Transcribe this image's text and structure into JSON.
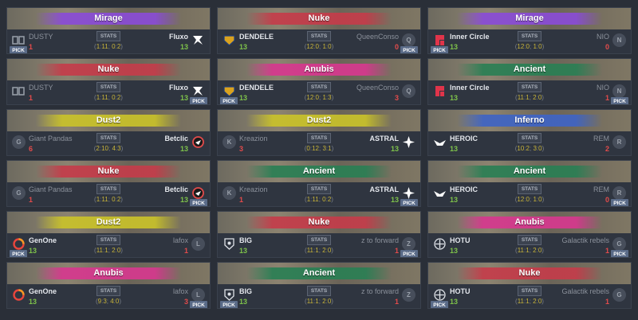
{
  "matches": [
    {
      "map": "Mirage",
      "banner": "#8a4cd6",
      "left": {
        "name": "DUSTY",
        "score": "1",
        "icon": "dusty-logo-icon",
        "pick": true,
        "win": false
      },
      "right": {
        "name": "Fluxo",
        "score": "13",
        "icon": "fluxo-logo-icon",
        "pick": false,
        "win": true
      },
      "halves": {
        "h1": [
          "1",
          "11"
        ],
        "h2": [
          "0",
          "2"
        ]
      }
    },
    {
      "map": "Nuke",
      "banner": "#c43c4a",
      "left": {
        "name": "DENDELE",
        "score": "13",
        "icon": "dendele-logo-icon",
        "pick": false,
        "win": true
      },
      "right": {
        "name": "QueenConso",
        "score": "0",
        "icon": "queenconso-placeholder-icon",
        "pick": true,
        "win": false
      },
      "halves": {
        "h1": [
          "12",
          "0"
        ],
        "h2": [
          "1",
          "0"
        ]
      }
    },
    {
      "map": "Mirage",
      "banner": "#8a4cd6",
      "left": {
        "name": "Inner Circle",
        "score": "13",
        "icon": "inner-circle-logo-icon",
        "pick": true,
        "win": true
      },
      "right": {
        "name": "NIO",
        "score": "0",
        "icon": "nio-placeholder-icon",
        "pick": false,
        "win": false
      },
      "halves": {
        "h1": [
          "12",
          "0"
        ],
        "h2": [
          "1",
          "0"
        ]
      }
    },
    {
      "map": "Nuke",
      "banner": "#c43c4a",
      "left": {
        "name": "DUSTY",
        "score": "1",
        "icon": "dusty-logo-icon",
        "pick": false,
        "win": false
      },
      "right": {
        "name": "Fluxo",
        "score": "13",
        "icon": "fluxo-logo-icon",
        "pick": true,
        "win": true
      },
      "halves": {
        "h1": [
          "1",
          "11"
        ],
        "h2": [
          "0",
          "2"
        ]
      }
    },
    {
      "map": "Anubis",
      "banner": "#d6388e",
      "left": {
        "name": "DENDELE",
        "score": "13",
        "icon": "dendele-logo-icon",
        "pick": true,
        "win": true
      },
      "right": {
        "name": "QueenConso",
        "score": "3",
        "icon": "queenconso-placeholder-icon",
        "pick": false,
        "win": false
      },
      "halves": {
        "h1": [
          "12",
          "0"
        ],
        "h2": [
          "1",
          "3"
        ]
      }
    },
    {
      "map": "Ancient",
      "banner": "#2a7f54",
      "left": {
        "name": "Inner Circle",
        "score": "13",
        "icon": "inner-circle-logo-icon",
        "pick": false,
        "win": true
      },
      "right": {
        "name": "NIO",
        "score": "1",
        "icon": "nio-placeholder-icon",
        "pick": true,
        "win": false
      },
      "halves": {
        "h1": [
          "11",
          "1"
        ],
        "h2": [
          "2",
          "0"
        ]
      }
    },
    {
      "map": "Dust2",
      "banner": "#c9c22a",
      "left": {
        "name": "Giant Pandas",
        "score": "6",
        "icon": "giant-pandas-placeholder-icon",
        "pick": false,
        "win": false
      },
      "right": {
        "name": "Betclic",
        "score": "13",
        "icon": "betclic-logo-icon",
        "pick": false,
        "win": true
      },
      "halves": {
        "h1": [
          "2",
          "10"
        ],
        "h2": [
          "4",
          "3"
        ]
      }
    },
    {
      "map": "Dust2",
      "banner": "#c9c22a",
      "left": {
        "name": "Kreazion",
        "score": "3",
        "icon": "kreazion-placeholder-icon",
        "pick": false,
        "win": false
      },
      "right": {
        "name": "ASTRAL",
        "score": "13",
        "icon": "astral-logo-icon",
        "pick": false,
        "win": true
      },
      "halves": {
        "h1": [
          "0",
          "12"
        ],
        "h2": [
          "3",
          "1"
        ]
      }
    },
    {
      "map": "Inferno",
      "banner": "#3f64c4",
      "left": {
        "name": "HEROIC",
        "score": "13",
        "icon": "heroic-logo-icon",
        "pick": false,
        "win": true
      },
      "right": {
        "name": "REM",
        "score": "2",
        "icon": "rem-placeholder-icon",
        "pick": false,
        "win": false
      },
      "halves": {
        "h1": [
          "10",
          "2"
        ],
        "h2": [
          "3",
          "0"
        ]
      }
    },
    {
      "map": "Nuke",
      "banner": "#c43c4a",
      "left": {
        "name": "Giant Pandas",
        "score": "1",
        "icon": "giant-pandas-placeholder-icon",
        "pick": false,
        "win": false
      },
      "right": {
        "name": "Betclic",
        "score": "13",
        "icon": "betclic-logo-icon",
        "pick": true,
        "win": true
      },
      "halves": {
        "h1": [
          "1",
          "11"
        ],
        "h2": [
          "0",
          "2"
        ]
      }
    },
    {
      "map": "Ancient",
      "banner": "#2a7f54",
      "left": {
        "name": "Kreazion",
        "score": "1",
        "icon": "kreazion-placeholder-icon",
        "pick": false,
        "win": false
      },
      "right": {
        "name": "ASTRAL",
        "score": "13",
        "icon": "astral-logo-icon",
        "pick": true,
        "win": true
      },
      "halves": {
        "h1": [
          "1",
          "11"
        ],
        "h2": [
          "0",
          "2"
        ]
      }
    },
    {
      "map": "Ancient",
      "banner": "#2a7f54",
      "left": {
        "name": "HEROIC",
        "score": "13",
        "icon": "heroic-logo-icon",
        "pick": false,
        "win": true
      },
      "right": {
        "name": "REM",
        "score": "0",
        "icon": "rem-placeholder-icon",
        "pick": true,
        "win": false
      },
      "halves": {
        "h1": [
          "12",
          "0"
        ],
        "h2": [
          "1",
          "0"
        ]
      }
    },
    {
      "map": "Dust2",
      "banner": "#c9c22a",
      "left": {
        "name": "GenOne",
        "score": "13",
        "icon": "genone-logo-icon",
        "pick": true,
        "win": true
      },
      "right": {
        "name": "lafox",
        "score": "1",
        "icon": "lafox-placeholder-icon",
        "pick": false,
        "win": false
      },
      "halves": {
        "h1": [
          "11",
          "1"
        ],
        "h2": [
          "2",
          "0"
        ]
      }
    },
    {
      "map": "Nuke",
      "banner": "#c43c4a",
      "left": {
        "name": "BIG",
        "score": "13",
        "icon": "big-logo-icon",
        "pick": false,
        "win": true
      },
      "right": {
        "name": "z to forward",
        "score": "1",
        "icon": "z-to-forward-placeholder-icon",
        "pick": true,
        "win": false
      },
      "halves": {
        "h1": [
          "11",
          "1"
        ],
        "h2": [
          "2",
          "0"
        ]
      }
    },
    {
      "map": "Anubis",
      "banner": "#d6388e",
      "left": {
        "name": "HOTU",
        "score": "13",
        "icon": "hotu-logo-icon",
        "pick": false,
        "win": true
      },
      "right": {
        "name": "Galactik rebels",
        "score": "1",
        "icon": "galactik-rebels-placeholder-icon",
        "pick": true,
        "win": false
      },
      "halves": {
        "h1": [
          "11",
          "1"
        ],
        "h2": [
          "2",
          "0"
        ]
      }
    },
    {
      "map": "Anubis",
      "banner": "#d6388e",
      "left": {
        "name": "GenOne",
        "score": "13",
        "icon": "genone-logo-icon",
        "pick": false,
        "win": true
      },
      "right": {
        "name": "lafox",
        "score": "3",
        "icon": "lafox-placeholder-icon",
        "pick": true,
        "win": false
      },
      "halves": {
        "h1": [
          "9",
          "3"
        ],
        "h2": [
          "4",
          "0"
        ]
      }
    },
    {
      "map": "Ancient",
      "banner": "#2a7f54",
      "left": {
        "name": "BIG",
        "score": "13",
        "icon": "big-logo-icon",
        "pick": true,
        "win": true
      },
      "right": {
        "name": "z to forward",
        "score": "1",
        "icon": "z-to-forward-placeholder-icon",
        "pick": false,
        "win": false
      },
      "halves": {
        "h1": [
          "11",
          "1"
        ],
        "h2": [
          "2",
          "0"
        ]
      }
    },
    {
      "map": "Nuke",
      "banner": "#c43c4a",
      "left": {
        "name": "HOTU",
        "score": "13",
        "icon": "hotu-logo-icon",
        "pick": true,
        "win": true
      },
      "right": {
        "name": "Galactik rebels",
        "score": "1",
        "icon": "galactik-rebels-placeholder-icon",
        "pick": false,
        "win": false
      },
      "halves": {
        "h1": [
          "11",
          "1"
        ],
        "h2": [
          "2",
          "0"
        ]
      }
    }
  ],
  "labels": {
    "stats": "STATS",
    "pick": "PICK"
  },
  "placeholder_letters": {
    "queenconso-placeholder-icon": "Q",
    "nio-placeholder-icon": "N",
    "giant-pandas-placeholder-icon": "G",
    "kreazion-placeholder-icon": "K",
    "rem-placeholder-icon": "R",
    "lafox-placeholder-icon": "L",
    "z-to-forward-placeholder-icon": "Z",
    "galactik-rebels-placeholder-icon": "G"
  },
  "colors": {
    "win": "#7ec24a",
    "lose": "#e34b4b",
    "pick_badge": "#5a6b88",
    "card_bg": "#2f3540",
    "page_bg": "#2a2f38"
  }
}
